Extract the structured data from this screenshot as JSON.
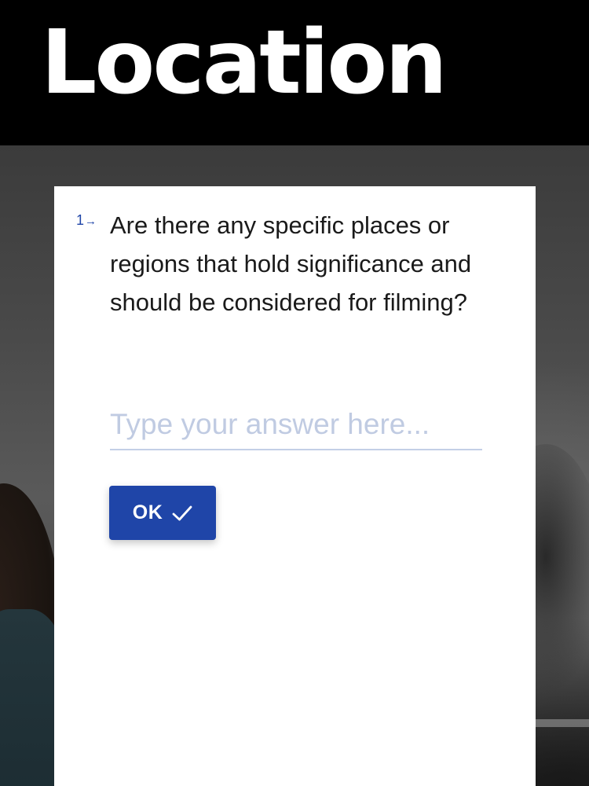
{
  "header": {
    "title": "Location"
  },
  "form": {
    "question_number": "1",
    "question_arrow_icon": "arrow-right-icon",
    "question_text": "Are there any specific places or regions that hold significance and should be considered for filming?",
    "answer": {
      "value": "",
      "placeholder": "Type your answer here..."
    },
    "ok_button": {
      "label": "OK",
      "icon": "check-icon"
    }
  },
  "colors": {
    "header_bg": "#000000",
    "header_text": "#ffffff",
    "accent": "#1f45a8",
    "placeholder": "#c0cbe2",
    "input_underline": "#c3cfe6",
    "card_bg": "#ffffff",
    "question_text": "#1a1a1a"
  }
}
